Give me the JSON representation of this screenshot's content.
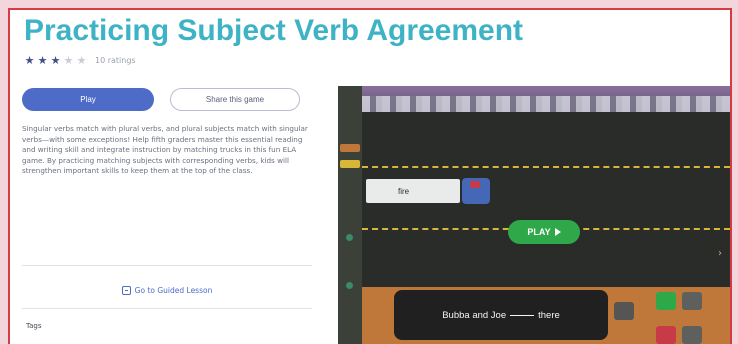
{
  "title": "Practicing Subject Verb Agreement",
  "rating": {
    "stars_filled": 3,
    "stars_total": 5,
    "count_text": "10 ratings"
  },
  "buttons": {
    "play": "Play",
    "share": "Share this game"
  },
  "description": "Singular verbs match with plural verbs, and plural subjects match with singular verbs—with some exceptions! Help fifth graders master this essential reading and writing skill and integrate instruction by matching trucks in this fun ELA game. By practicing matching subjects with corresponding verbs, kids will strengthen important skills to keep them at the top of the class.",
  "link_text": "Go to Guided Lesson",
  "tags_label": "Tags",
  "game": {
    "word_card": "fire",
    "play_label": "PLAY",
    "sentence_before": "Bubba and Joe",
    "sentence_after": "there"
  },
  "colors": {
    "title": "#3fb3c6",
    "primary": "#4d6bc7",
    "frame_border": "#d63a44",
    "play_green": "#2fa84a"
  }
}
